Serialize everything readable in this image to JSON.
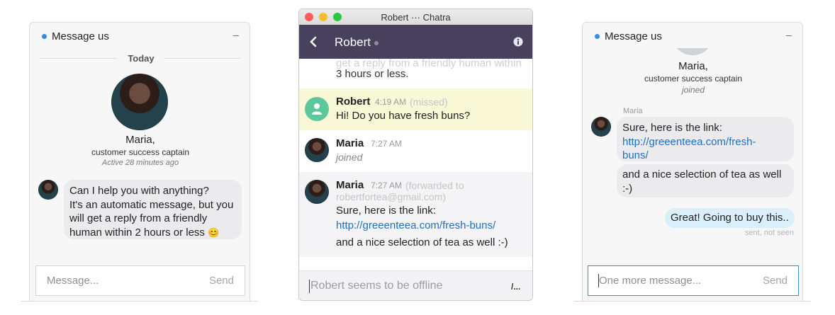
{
  "left_widget": {
    "title": "Message us",
    "minimize": "–",
    "date_divider": "Today",
    "agent_name": "Maria,",
    "agent_role": "customer success captain",
    "agent_status": "Active 28 minutes ago",
    "auto_message": [
      "Can I help you with anything?",
      "It's an automatic message, but you",
      "will get a reply from a friendly",
      "human within 2 hours or less"
    ],
    "emoji": "😊",
    "input_placeholder": "Message...",
    "send_label": "Send"
  },
  "middle_window": {
    "window_title": "Robert ··· Chatra",
    "contact_name": "Robert",
    "back_icon": "chevron-left-icon",
    "info_icon": "info-icon",
    "top_cut_text_1": "get a reply from a friendly human within",
    "top_cut_text_2": "3 hours or less.",
    "messages": [
      {
        "name": "Robert",
        "time": "4:19 AM",
        "note": "(missed)",
        "text": "Hi! Do you have fresh buns?"
      },
      {
        "name": "Maria",
        "time": "7:27 AM",
        "note": "",
        "text": "joined"
      },
      {
        "name": "Maria",
        "time": "7:27 AM",
        "note": "(forwarded to",
        "note2": "robertfortea@gmail.com)",
        "text": "Sure, here is the link:",
        "link": "http://greeenteea.com/fresh-buns/",
        "text2": "and a nice selection of tea as well :-)"
      }
    ],
    "input_placeholder": "Robert seems to be offline",
    "attach_icon": "/..."
  },
  "right_widget": {
    "title": "Message us",
    "minimize": "–",
    "agent_name": "Maria,",
    "agent_role": "customer success captain",
    "agent_status": "joined",
    "sender_label": "Maria",
    "bubble1_text": "Sure, here is the link:",
    "bubble1_link_1": "http://greeenteea.com/fresh-",
    "bubble1_link_2": "buns/",
    "bubble2_text_1": "and a nice selection of tea as well",
    "bubble2_text_2": ":-)",
    "outgoing_text": "Great! Going to buy this..",
    "outgoing_status": "sent, not seen",
    "input_value": "One more message...",
    "send_label": "Send"
  },
  "colors": {
    "accent_blue": "#2f8ee6",
    "navbar": "#47415e",
    "missed_highlight": "#f8f7d6",
    "outgoing_bubble": "#d9f0fa",
    "link": "#1f6fbf"
  }
}
